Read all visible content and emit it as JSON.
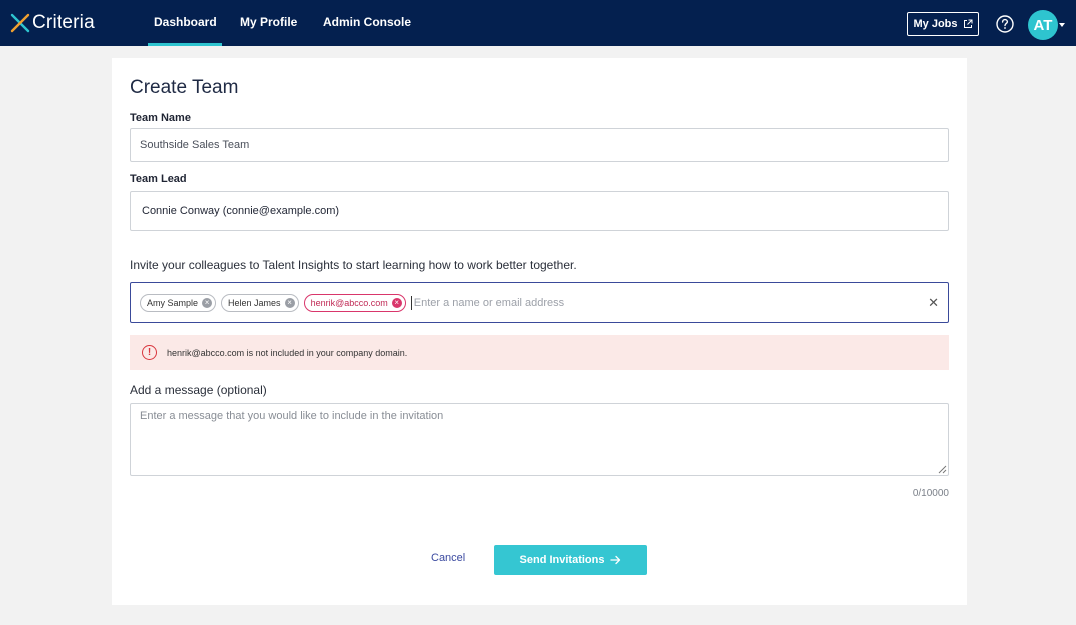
{
  "header": {
    "brand": "Criteria",
    "nav": [
      {
        "label": "Dashboard",
        "active": true
      },
      {
        "label": "My Profile",
        "active": false
      },
      {
        "label": "Admin Console",
        "active": false
      }
    ],
    "my_jobs_label": "My Jobs",
    "avatar_initials": "AT",
    "accent_color": "#2ec4cf",
    "nav_bg_color": "#04204f"
  },
  "form": {
    "title": "Create Team",
    "team_name_label": "Team Name",
    "team_name_value": "Southside Sales Team",
    "team_lead_label": "Team Lead",
    "team_lead_value": "Connie Conway (connie@example.com)",
    "invite_text": "Invite your colleagues to Talent Insights to start learning how to work better together.",
    "invitees": [
      {
        "label": "Amy Sample",
        "error": false
      },
      {
        "label": "Helen James",
        "error": false
      },
      {
        "label": "henrik@abcco.com",
        "error": true
      }
    ],
    "invite_placeholder": "Enter a name or email address",
    "error_message": "henrik@abcco.com is not included in your company domain.",
    "message_label": "Add a message (optional)",
    "message_placeholder": "Enter a message that you would like to include in the invitation",
    "char_counter": "0/10000",
    "cancel_label": "Cancel",
    "send_label": "Send Invitations"
  }
}
